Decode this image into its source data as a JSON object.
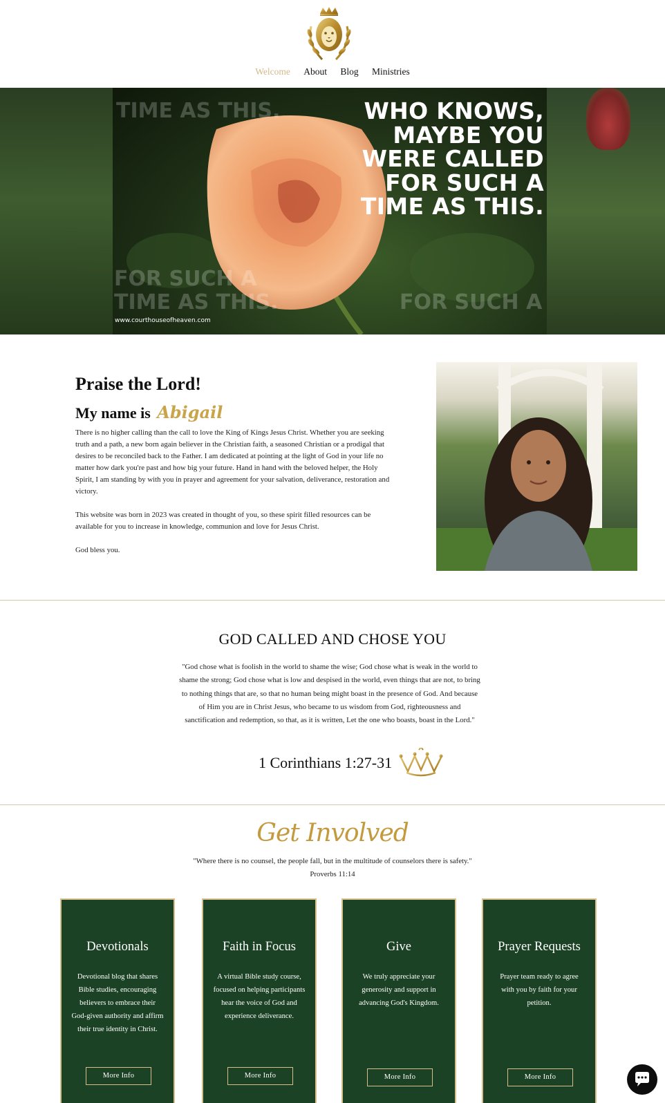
{
  "nav": {
    "items": [
      {
        "label": "Welcome",
        "active": true
      },
      {
        "label": "About",
        "active": false
      },
      {
        "label": "Blog",
        "active": false
      },
      {
        "label": "Ministries",
        "active": false
      }
    ]
  },
  "hero": {
    "headline": [
      "WHO KNOWS,",
      "MAYBE YOU",
      "WERE CALLED",
      "FOR SUCH A",
      "TIME AS THIS."
    ],
    "ghost_top": "TIME AS THIS.",
    "ghost_bottom_left": [
      "FOR SUCH A",
      "TIME AS THIS."
    ],
    "ghost_bottom_right": "FOR SUCH A",
    "url": "www.courthouseofheaven.com"
  },
  "intro": {
    "heading": "Praise the Lord!",
    "name_prefix": "My name is",
    "name": "Abigail",
    "paragraphs": [
      "There is no higher calling than the call to love the King of Kings Jesus Christ. Whether you are seeking truth and a path, a new born again believer in the Christian faith, a seasoned Christian or a prodigal that desires to be reconciled back to the Father. I am dedicated at pointing at the light of God in your life no matter how dark you're past and how big your future.  Hand in hand with the beloved helper, the Holy Spirit, I am standing by with you in prayer and agreement for your salvation, deliverance, restoration and victory.",
      "This website was born in 2023 was created in thought of you, so these spirit filled resources can be available for you to increase in knowledge, communion and love for Jesus Christ.",
      "God bless you."
    ]
  },
  "verse": {
    "title": "GOD CALLED AND CHOSE YOU",
    "text": "\"God chose what is foolish in the world to shame the wise; God chose what is weak in the world to shame the strong; God chose what is low and despised in the world, even things that are not, to bring to nothing things that are, so that no human being might boast in the presence of God. And because of Him you are in Christ Jesus, who became to us wisdom from God, righteousness and sanctification and redemption, so that, as it is written, Let the one who boasts, boast in the Lord.\"",
    "reference": "1 Corinthians 1:27-31"
  },
  "get_involved": {
    "title": "Get Involved",
    "quote": "\"Where there is no counsel, the people fall, but in the multitude of counselors there is safety.\"",
    "reference": "Proverbs 11:14",
    "cards": [
      {
        "title": "Devotionals",
        "description": "Devotional blog that shares Bible studies, encouraging believers to embrace their God-given authority and affirm their true identity in Christ.",
        "button": "More Info"
      },
      {
        "title": "Faith in Focus",
        "description": "A virtual Bible study course, focused on helping participants hear the voice of God and experience deliverance.",
        "button": "More Info"
      },
      {
        "title": "Give",
        "description": "We truly appreciate your generosity and support in advancing God's Kingdom.",
        "button": "More Info"
      },
      {
        "title": "Prayer Requests",
        "description": "Prayer team ready to agree with you by faith for your petition.",
        "button": "More Info"
      }
    ]
  },
  "colors": {
    "gold": "#c9a44a",
    "card_green": "#1c4226",
    "nav_active": "#d4b98a"
  },
  "icons": {
    "logo": "lion-crown-laurel-logo",
    "crown": "crown-icon",
    "chat": "chat-bubble-icon"
  }
}
